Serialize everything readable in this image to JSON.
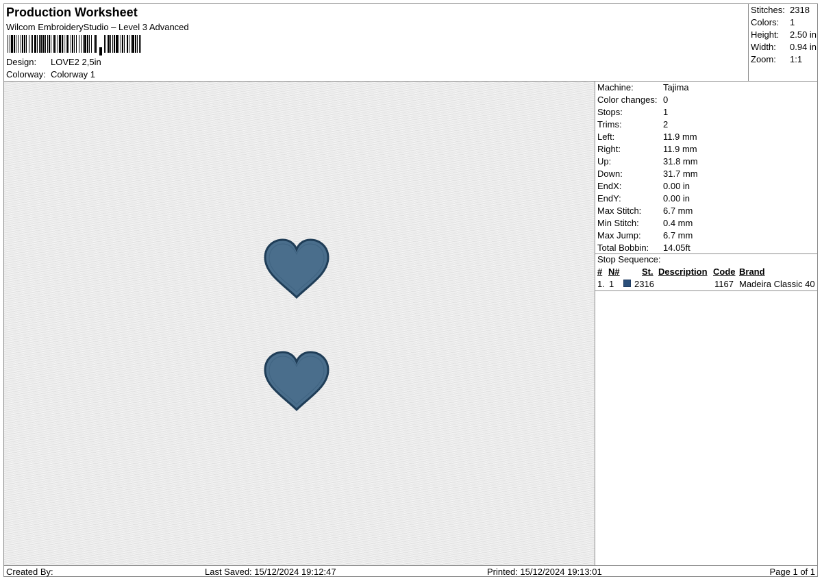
{
  "header": {
    "title": "Production Worksheet",
    "subtitle": "Wilcom EmbroideryStudio – Level 3 Advanced",
    "design_label": "Design:",
    "design_value": "LOVE2  2,5in",
    "colorway_label": "Colorway:",
    "colorway_value": "Colorway 1"
  },
  "stats": [
    {
      "label": "Stitches:",
      "value": "2318"
    },
    {
      "label": "Colors:",
      "value": "1"
    },
    {
      "label": "Height:",
      "value": "2.50 in"
    },
    {
      "label": "Width:",
      "value": "0.94 in"
    },
    {
      "label": "Zoom:",
      "value": "1:1"
    }
  ],
  "machine_info": [
    {
      "label": "Machine:",
      "value": "Tajima"
    },
    {
      "label": "Color changes:",
      "value": "0"
    },
    {
      "label": "Stops:",
      "value": "1"
    },
    {
      "label": "Trims:",
      "value": "2"
    },
    {
      "label": "Left:",
      "value": "11.9 mm"
    },
    {
      "label": "Right:",
      "value": "11.9 mm"
    },
    {
      "label": "Up:",
      "value": "31.8 mm"
    },
    {
      "label": "Down:",
      "value": "31.7 mm"
    },
    {
      "label": "EndX:",
      "value": "0.00 in"
    },
    {
      "label": "EndY:",
      "value": "0.00 in"
    },
    {
      "label": "Max Stitch:",
      "value": "6.7 mm"
    },
    {
      "label": "Min Stitch:",
      "value": "0.4 mm"
    },
    {
      "label": "Max Jump:",
      "value": "6.7 mm"
    },
    {
      "label": "Total Bobbin:",
      "value": "14.05ft"
    }
  ],
  "stop_sequence": {
    "title": "Stop Sequence:",
    "headers": {
      "index": "#",
      "needle": "N#",
      "stitches": "St.",
      "description": "Description",
      "code": "Code",
      "brand": "Brand"
    },
    "rows": [
      {
        "index": "1.",
        "needle": "1",
        "color": "#2b4f7a",
        "stitches": "2316",
        "description": "",
        "code": "1167",
        "brand": "Madeira Classic 40"
      }
    ]
  },
  "colors": {
    "thread": "#4a6e8c",
    "thread_outline": "#1f3d57",
    "fabric": "#e9e9e9"
  },
  "footer": {
    "created_by": "Created By:",
    "last_saved": "Last Saved: 15/12/2024 19:12:47",
    "printed": "Printed: 15/12/2024 19:13:01",
    "page": "Page 1 of 1"
  }
}
